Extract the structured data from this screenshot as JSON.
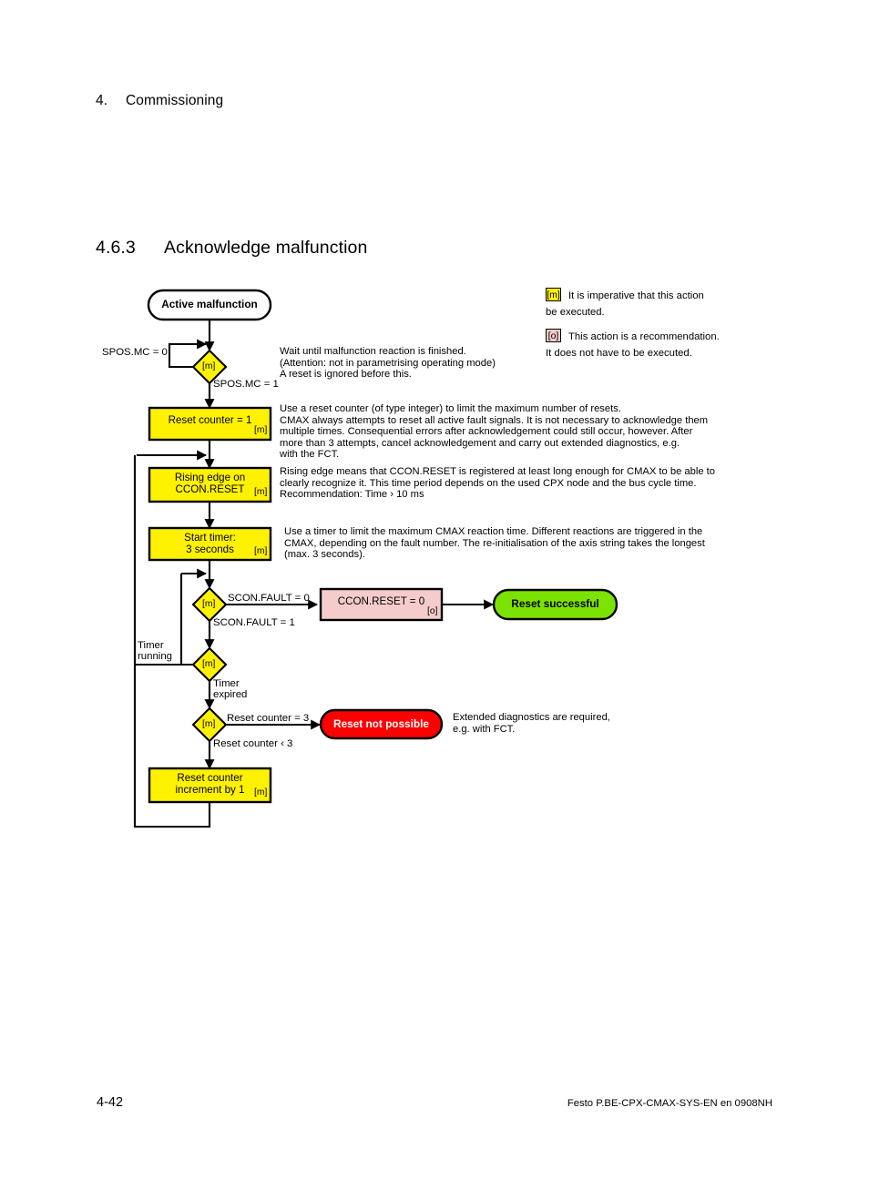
{
  "document": {
    "chapter_number": "4.",
    "chapter_title": "Commissioning",
    "section_number": "4.6.3",
    "section_title": "Acknowledge malfunction",
    "footer_page": "4-42",
    "footer_reference": "Festo  P.BE-CPX-CMAX-SYS-EN  en 0908NH"
  },
  "legend": {
    "items": [
      {
        "badge": "[m]",
        "text": "It is imperative that this action\nbe executed."
      },
      {
        "badge": "[o]",
        "text": "This action is a recommendation.\nIt does not have to be executed."
      }
    ]
  },
  "colors": {
    "mandatory_yellow": "#FFF200",
    "optional_pink": "#F4CCCC",
    "success_green": "#7CE300",
    "failure_red": "#FF0000",
    "line_black": "#000000"
  },
  "flowchart": {
    "nodes": {
      "start": {
        "label": "Active malfunction",
        "type": "terminator"
      },
      "decision_mc": {
        "label": "[m]",
        "type": "decision"
      },
      "reset_counter_init": {
        "label": "Reset counter = 1",
        "tag": "[m]",
        "type": "process"
      },
      "rising_edge": {
        "label": "Rising edge on\nCCON.RESET",
        "tag": "[m]",
        "type": "process"
      },
      "start_timer": {
        "label": "Start timer:\n3 seconds",
        "tag": "[m]",
        "type": "process"
      },
      "decision_fault": {
        "label": "[m]",
        "type": "decision"
      },
      "ccon_reset_zero": {
        "label": "CCON.RESET = 0",
        "tag": "[o]",
        "type": "process_optional"
      },
      "reset_successful": {
        "label": "Reset successful",
        "type": "terminator_success"
      },
      "decision_timer": {
        "label": "[m]",
        "type": "decision"
      },
      "decision_counter": {
        "label": "[m]",
        "type": "decision"
      },
      "reset_not_possible": {
        "label": "Reset not possible",
        "type": "terminator_failure"
      },
      "counter_increment": {
        "label": "Reset counter\nincrement by 1",
        "tag": "[m]",
        "type": "process"
      }
    },
    "edge_labels": {
      "mc_false": "SPOS.MC = 0",
      "mc_true": "SPOS.MC = 1",
      "fault_false": "SCON.FAULT = 0",
      "fault_true": "SCON.FAULT = 1",
      "timer_running": "Timer\nrunning",
      "timer_expired": "Timer\nexpired",
      "counter_eq3": "Reset counter = 3",
      "counter_lt3": "Reset counter ‹ 3"
    },
    "annotations": {
      "wait_malfunction": "Wait until malfunction reaction is finished.\n(Attention: not in parametrising operating mode)\nA reset is ignored before this.",
      "reset_counter": "Use a reset counter (of type integer) to limit the maximum number of resets.\nCMAX always attempts to reset all active fault signals. It is not necessary to acknowledge them\nmultiple times. Consequential errors after acknowledgement could still occur, however. After\nmore than 3 attempts, cancel acknowledgement and carry out extended diagnostics, e.g.\nwith the FCT.",
      "rising_edge": "Rising edge means that CCON.RESET is registered at least long enough for CMAX to be able to\nclearly recognize it. This time period depends on the used CPX node and the bus cycle time.\nRecommendation: Time › 10 ms",
      "start_timer": "Use a timer to limit the maximum CMAX reaction time. Different reactions are triggered in the\nCMAX, depending on the fault number. The re-initialisation of the axis string takes the longest\n(max. 3 seconds).",
      "extended_diagnostics": "Extended diagnostics are required,\ne.g. with FCT."
    }
  }
}
